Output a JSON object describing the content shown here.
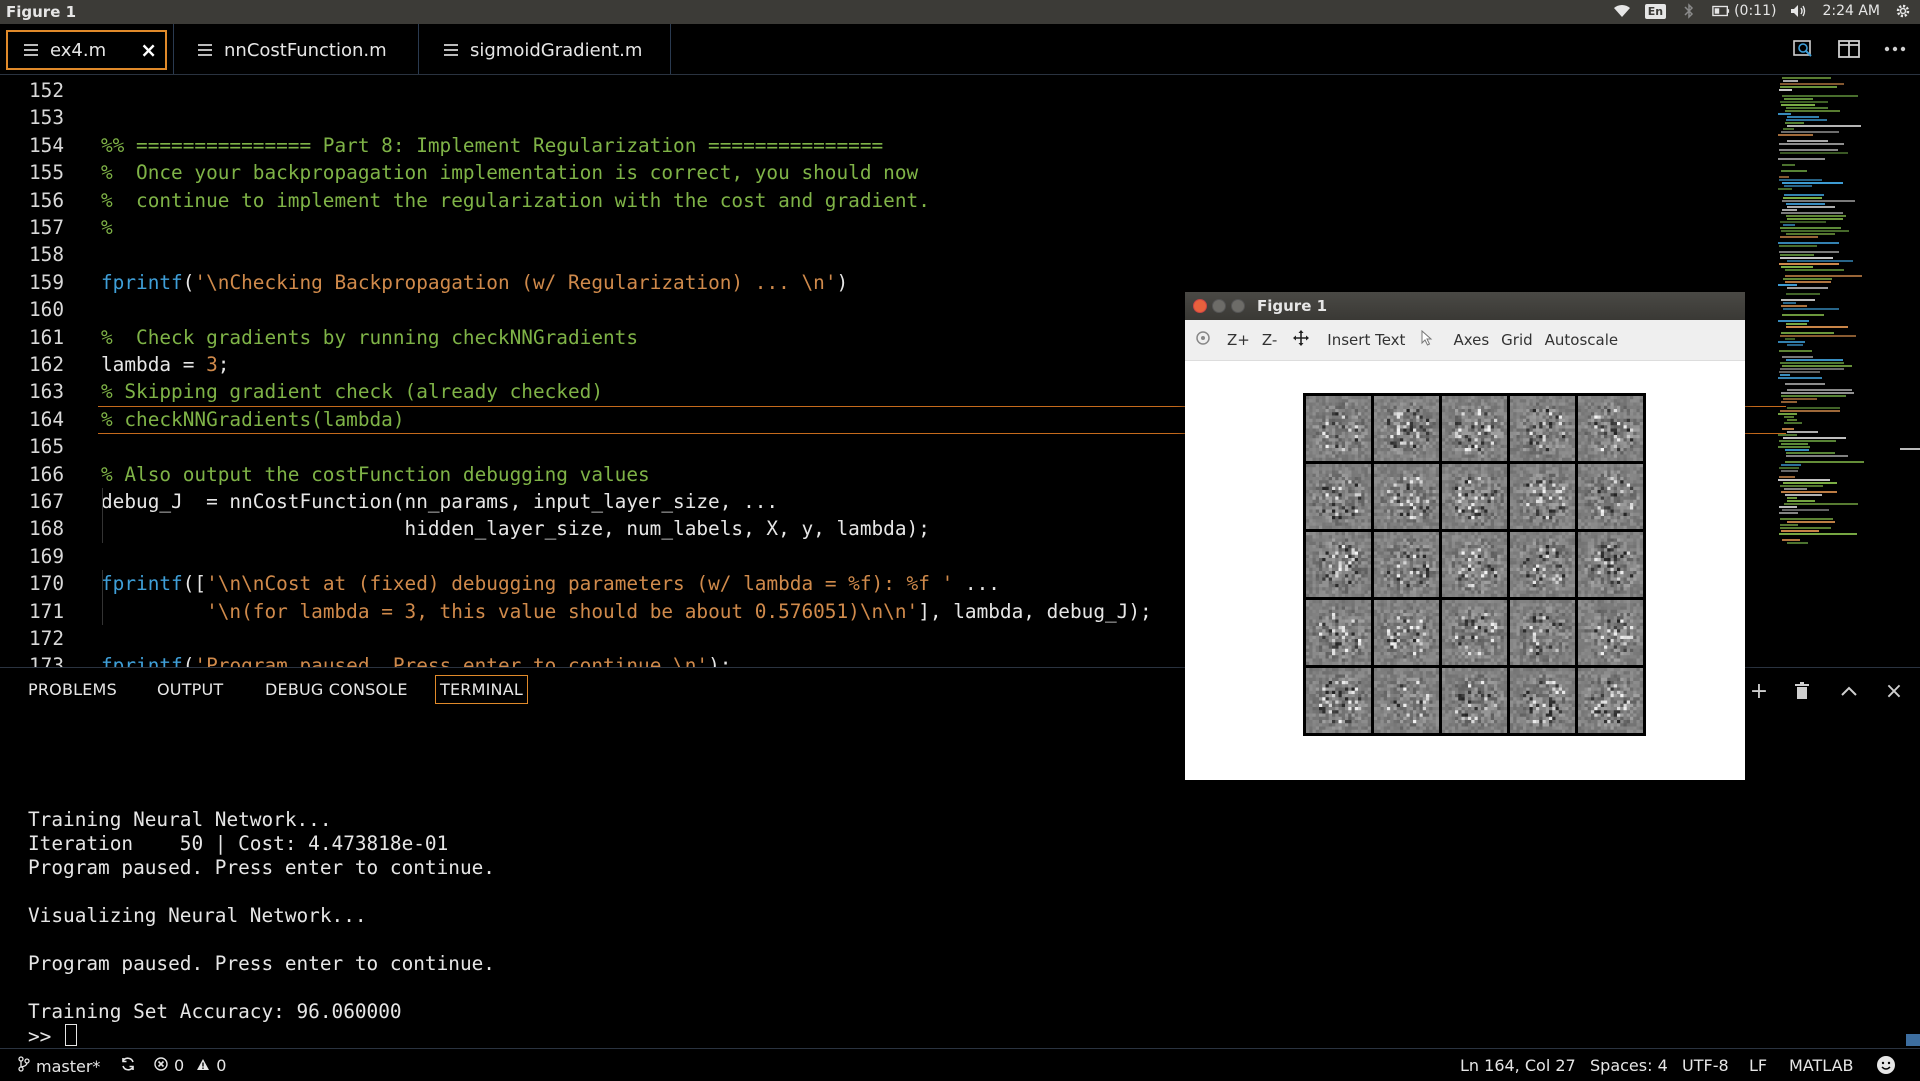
{
  "os": {
    "window_title": "Figure 1",
    "keyboard_layout": "En",
    "battery": "(0:11)",
    "clock": "2:24 AM"
  },
  "tabs": [
    {
      "label": "ex4.m",
      "active": true
    },
    {
      "label": "nnCostFunction.m",
      "active": false
    },
    {
      "label": "sigmoidGradient.m",
      "active": false
    }
  ],
  "editor": {
    "current_line": 164,
    "lines": [
      {
        "n": "152",
        "tokens": []
      },
      {
        "n": "153",
        "tokens": []
      },
      {
        "n": "154",
        "tokens": [
          {
            "t": "%% =============== Part 8: Implement Regularization ===============",
            "c": "comment"
          }
        ]
      },
      {
        "n": "155",
        "tokens": [
          {
            "t": "%  Once your backpropagation implementation is correct, you should now",
            "c": "comment"
          }
        ]
      },
      {
        "n": "156",
        "tokens": [
          {
            "t": "%  continue to implement the regularization with the cost and gradient.",
            "c": "comment"
          }
        ]
      },
      {
        "n": "157",
        "tokens": [
          {
            "t": "%",
            "c": "comment"
          }
        ]
      },
      {
        "n": "158",
        "tokens": []
      },
      {
        "n": "159",
        "tokens": [
          {
            "t": "fprintf",
            "c": "kw"
          },
          {
            "t": "(",
            "c": "id"
          },
          {
            "t": "'\\nChecking Backpropagation (w/ Regularization) ... \\n'",
            "c": "str"
          },
          {
            "t": ")",
            "c": "id"
          }
        ]
      },
      {
        "n": "160",
        "tokens": []
      },
      {
        "n": "161",
        "tokens": [
          {
            "t": "%  Check gradients by running checkNNGradients",
            "c": "comment"
          }
        ]
      },
      {
        "n": "162",
        "tokens": [
          {
            "t": "lambda = ",
            "c": "id"
          },
          {
            "t": "3",
            "c": "num"
          },
          {
            "t": ";",
            "c": "id"
          }
        ]
      },
      {
        "n": "163",
        "tokens": [
          {
            "t": "% Skipping gradient check (already checked)",
            "c": "comment"
          }
        ]
      },
      {
        "n": "164",
        "tokens": [
          {
            "t": "% checkNNGradients(lambda)",
            "c": "comment"
          }
        ]
      },
      {
        "n": "165",
        "tokens": []
      },
      {
        "n": "166",
        "tokens": [
          {
            "t": "% Also output the costFunction debugging values",
            "c": "comment"
          }
        ]
      },
      {
        "n": "167",
        "tokens": [
          {
            "t": "debug_J  = nnCostFunction(nn_params, input_layer_size, ...",
            "c": "id"
          }
        ]
      },
      {
        "n": "168",
        "tokens": [
          {
            "t": "                          hidden_layer_size, num_labels, X, y, lambda);",
            "c": "id"
          }
        ]
      },
      {
        "n": "169",
        "tokens": []
      },
      {
        "n": "170",
        "tokens": [
          {
            "t": "fprintf",
            "c": "kw"
          },
          {
            "t": "([",
            "c": "id"
          },
          {
            "t": "'\\n\\nCost at (fixed) debugging parameters (w/ lambda = %f): %f '",
            "c": "str"
          },
          {
            "t": " ...",
            "c": "id"
          }
        ]
      },
      {
        "n": "171",
        "tokens": [
          {
            "t": "         ",
            "c": "id"
          },
          {
            "t": "'\\n(for lambda = 3, this value should be about 0.576051)\\n\\n'",
            "c": "str"
          },
          {
            "t": "], lambda, debug_J);",
            "c": "id"
          }
        ]
      },
      {
        "n": "172",
        "tokens": []
      },
      {
        "n": "173",
        "tokens": [
          {
            "t": "fprintf",
            "c": "kw"
          },
          {
            "t": "(",
            "c": "id"
          },
          {
            "t": "'Program paused. Press enter to continue.\\n'",
            "c": "str"
          },
          {
            "t": ");",
            "c": "id"
          }
        ]
      }
    ]
  },
  "panel": {
    "tabs": [
      "PROBLEMS",
      "OUTPUT",
      "DEBUG CONSOLE",
      "TERMINAL"
    ],
    "active_tab": "TERMINAL",
    "terminal_lines": [
      "Training Neural Network...",
      "Iteration    50 | Cost: 4.473818e-01",
      "Program paused. Press enter to continue.",
      "",
      "Visualizing Neural Network...",
      "",
      "Program paused. Press enter to continue.",
      "",
      "Training Set Accuracy: 96.060000"
    ],
    "prompt": ">> "
  },
  "status": {
    "branch": "master*",
    "errors": "0",
    "warnings": "0",
    "position": "Ln 164, Col 27",
    "spaces": "Spaces: 4",
    "encoding": "UTF-8",
    "eol": "LF",
    "language": "MATLAB"
  },
  "figure": {
    "title": "Figure 1",
    "toolbar": [
      "Z+",
      "Z-",
      "Insert Text",
      "Axes",
      "Grid",
      "Autoscale"
    ],
    "grid_rows": 5,
    "grid_cols": 5
  },
  "colors": {
    "accent": "#e08a2a",
    "comment": "#7fb347",
    "keyword": "#3f9fd8",
    "string": "#d08a4b"
  }
}
